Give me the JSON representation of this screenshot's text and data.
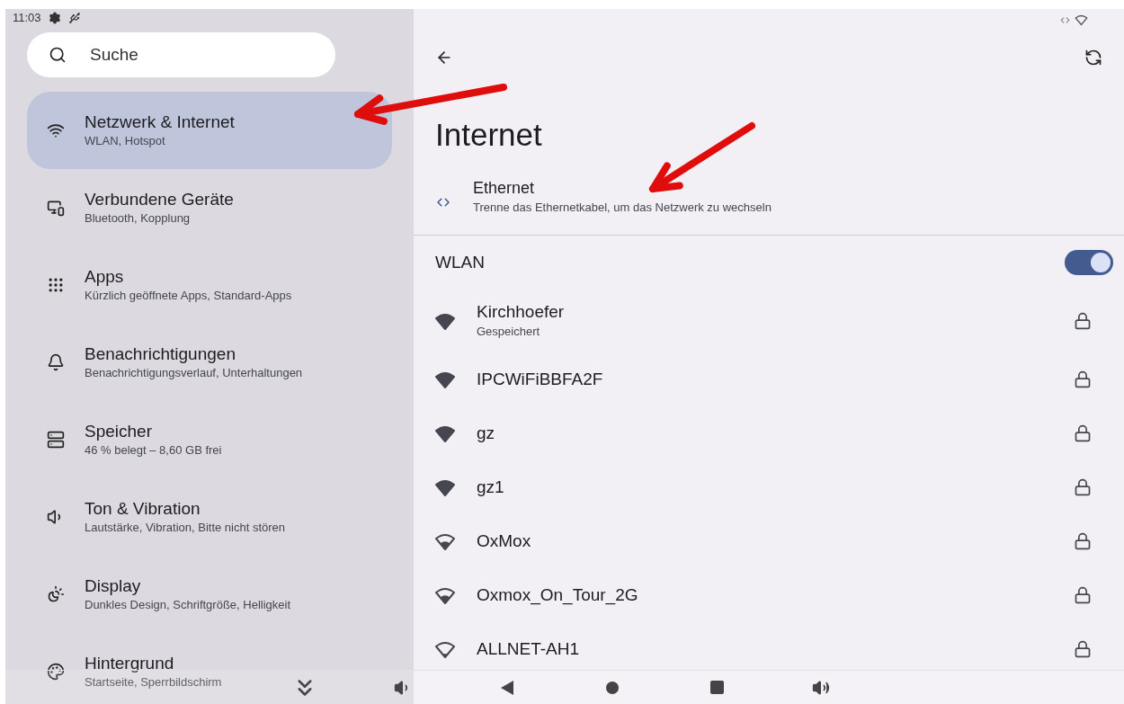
{
  "status_bar": {
    "time": "11:03"
  },
  "search": {
    "placeholder": "Suche"
  },
  "sidebar": {
    "items": [
      {
        "title": "Netzwerk & Internet",
        "subtitle": "WLAN, Hotspot",
        "selected": true
      },
      {
        "title": "Verbundene Geräte",
        "subtitle": "Bluetooth, Kopplung",
        "selected": false
      },
      {
        "title": "Apps",
        "subtitle": "Kürzlich geöffnete Apps, Standard-Apps",
        "selected": false
      },
      {
        "title": "Benachrichtigungen",
        "subtitle": "Benachrichtigungsverlauf, Unterhaltungen",
        "selected": false
      },
      {
        "title": "Speicher",
        "subtitle": "46 % belegt – 8,60 GB frei",
        "selected": false
      },
      {
        "title": "Ton & Vibration",
        "subtitle": "Lautstärke, Vibration, Bitte nicht stören",
        "selected": false
      },
      {
        "title": "Display",
        "subtitle": "Dunkles Design, Schriftgröße, Helligkeit",
        "selected": false
      },
      {
        "title": "Hintergrund",
        "subtitle": "Startseite, Sperrbildschirm",
        "selected": false
      }
    ]
  },
  "main": {
    "title": "Internet",
    "ethernet": {
      "title": "Ethernet",
      "subtitle": "Trenne das Ethernetkabel, um das Netzwerk zu wechseln"
    },
    "wlan": {
      "label": "WLAN",
      "on": true
    },
    "networks": [
      {
        "name": "Kirchhoefer",
        "status": "Gespeichert",
        "kind": "strong",
        "locked": true
      },
      {
        "name": "IPCWiFiBBFA2F",
        "kind": "strong",
        "locked": true
      },
      {
        "name": "gz",
        "kind": "strong",
        "locked": true
      },
      {
        "name": "gz1",
        "kind": "strong",
        "locked": true
      },
      {
        "name": "OxMox",
        "kind": "medium",
        "locked": true
      },
      {
        "name": "Oxmox_On_Tour_2G",
        "kind": "medium",
        "locked": true
      },
      {
        "name": "ALLNET-AH1",
        "kind": "weak",
        "locked": true
      }
    ]
  }
}
